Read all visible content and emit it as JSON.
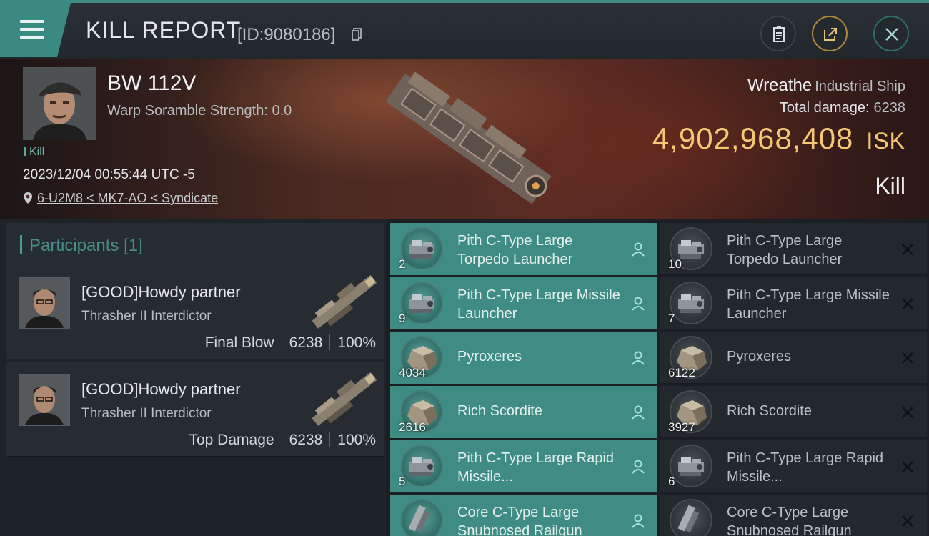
{
  "header": {
    "title": "KILL REPORT",
    "report_id": "[ID:9080186]"
  },
  "victim": {
    "name": "BW 112V",
    "warp_scramble": "Warp Soramble Strength: 0.0",
    "tag": "Kill",
    "datetime": "2023/12/04 00:55:44 UTC -5",
    "location": "6-U2M8 < MK7-AO < Syndicate"
  },
  "ship": {
    "name": "Wreathe",
    "class": "Industrial Ship",
    "total_damage_label": "Total damage:",
    "total_damage": "6238",
    "isk_value": "4,902,968,408",
    "isk_unit": "ISK",
    "result": "Kill"
  },
  "participants": {
    "header": "Participants",
    "count": "[1]",
    "list": [
      {
        "name": "[GOOD]Howdy partner",
        "ship": "Thrasher II Interdictor",
        "role": "Final Blow",
        "damage": "6238",
        "percent": "100%"
      },
      {
        "name": "[GOOD]Howdy partner",
        "ship": "Thrasher II Interdictor",
        "role": "Top Damage",
        "damage": "6238",
        "percent": "100%"
      }
    ]
  },
  "items": {
    "rows": [
      {
        "destroyed": {
          "qty": "2",
          "name": "Pith C-Type Large Torpedo Launcher",
          "icon": "launcher-icon"
        },
        "dropped": {
          "qty": "10",
          "name": "Pith C-Type Large Torpedo Launcher",
          "icon": "launcher-icon"
        }
      },
      {
        "destroyed": {
          "qty": "9",
          "name": "Pith C-Type Large Missile Launcher",
          "icon": "launcher-icon"
        },
        "dropped": {
          "qty": "7",
          "name": "Pith C-Type Large Missile Launcher",
          "icon": "launcher-icon"
        }
      },
      {
        "destroyed": {
          "qty": "4034",
          "name": "Pyroxeres",
          "icon": "ore-icon"
        },
        "dropped": {
          "qty": "6122",
          "name": "Pyroxeres",
          "icon": "ore-icon"
        }
      },
      {
        "destroyed": {
          "qty": "2616",
          "name": "Rich Scordite",
          "icon": "ore-icon"
        },
        "dropped": {
          "qty": "3927",
          "name": "Rich Scordite",
          "icon": "ore-icon"
        }
      },
      {
        "destroyed": {
          "qty": "5",
          "name": "Pith C-Type Large Rapid Missile...",
          "icon": "launcher-icon"
        },
        "dropped": {
          "qty": "6",
          "name": "Pith C-Type Large Rapid Missile...",
          "icon": "launcher-icon"
        }
      },
      {
        "destroyed": {
          "qty": "",
          "name": "Core C-Type Large Snubnosed Railgun",
          "icon": "railgun-icon"
        },
        "dropped": {
          "qty": "",
          "name": "Core C-Type Large Snubnosed Railgun",
          "icon": "railgun-icon"
        }
      }
    ]
  },
  "colors": {
    "accent": "#3f8c84",
    "isk": "#f4c875",
    "hero_red": "#5a2c24"
  }
}
